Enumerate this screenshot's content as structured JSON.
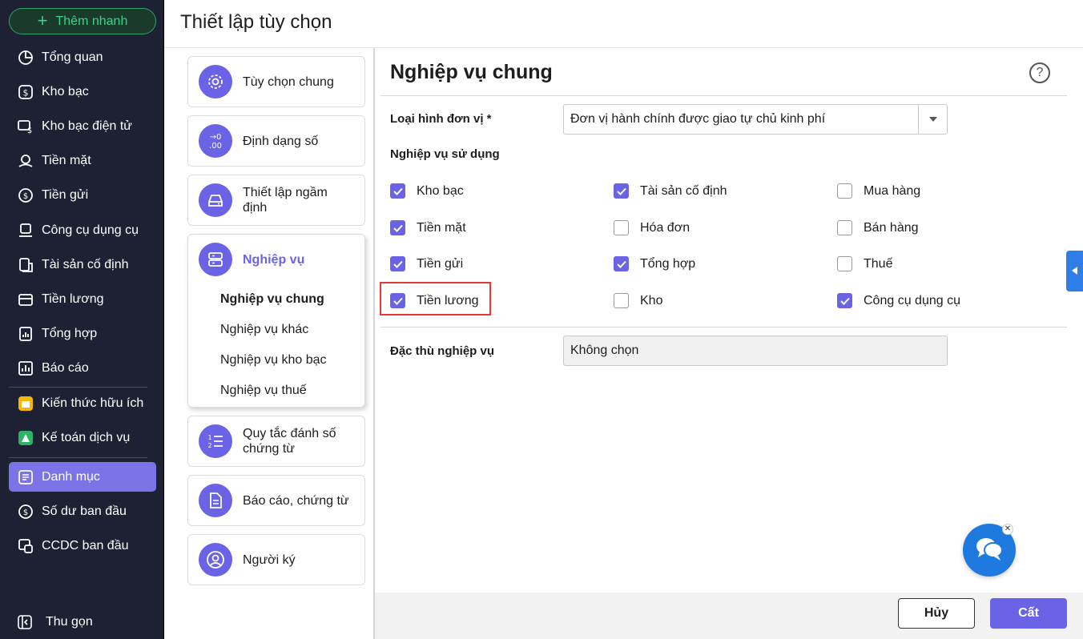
{
  "sidebar": {
    "quick_add_label": "Thêm nhanh",
    "items": [
      {
        "label": "Tổng quan",
        "icon": "pie-chart-icon"
      },
      {
        "label": "Kho bạc",
        "icon": "dollar-icon"
      },
      {
        "label": "Kho bạc điện tử",
        "icon": "e-treasury-icon"
      },
      {
        "label": "Tiền mặt",
        "icon": "cash-icon"
      },
      {
        "label": "Tiền gửi",
        "icon": "deposit-icon"
      },
      {
        "label": "Công cụ dụng cụ",
        "icon": "tools-icon"
      },
      {
        "label": "Tài sản cố định",
        "icon": "assets-icon"
      },
      {
        "label": "Tiền lương",
        "icon": "salary-icon"
      },
      {
        "label": "Tổng hợp",
        "icon": "summary-icon"
      },
      {
        "label": "Báo cáo",
        "icon": "report-icon"
      },
      {
        "label": "Kiến thức hữu ích",
        "icon": "knowledge-icon"
      },
      {
        "label": "Kế toán dịch vụ",
        "icon": "service-icon"
      },
      {
        "label": "Danh mục",
        "icon": "catalog-icon"
      },
      {
        "label": "Số dư ban đầu",
        "icon": "opening-balance-icon"
      },
      {
        "label": "CCDC ban đầu",
        "icon": "opening-tools-icon"
      }
    ],
    "collapse_label": "Thu gọn"
  },
  "page": {
    "title": "Thiết lập tùy chọn"
  },
  "menu": {
    "general": "Tùy chọn chung",
    "number_format": "Định dạng số",
    "defaults": "Thiết lập ngầm định",
    "business": "Nghiệp vụ",
    "sub": [
      "Nghiệp vụ chung",
      "Nghiệp vụ khác",
      "Nghiệp vụ kho bạc",
      "Nghiệp vụ thuế"
    ],
    "numbering": "Quy tắc đánh số chứng từ",
    "reports": "Báo cáo, chứng từ",
    "signer": "Người ký"
  },
  "content": {
    "title": "Nghiệp vụ chung",
    "help": "?",
    "unit_type_label": "Loại hình đơn vị *",
    "unit_type_value": "Đơn vị hành chính được giao tự chủ kinh phí",
    "used_label": "Nghiệp vụ sử dụng",
    "checkboxes": [
      {
        "label": "Kho bạc",
        "checked": true
      },
      {
        "label": "Tài sản cố định",
        "checked": true
      },
      {
        "label": "Mua hàng",
        "checked": false
      },
      {
        "label": "Tiền mặt",
        "checked": true
      },
      {
        "label": "Hóa đơn",
        "checked": false
      },
      {
        "label": "Bán hàng",
        "checked": false
      },
      {
        "label": "Tiền gửi",
        "checked": true
      },
      {
        "label": "Tổng hợp",
        "checked": true
      },
      {
        "label": "Thuế",
        "checked": false
      },
      {
        "label": "Tiền lương",
        "checked": true
      },
      {
        "label": "Kho",
        "checked": false
      },
      {
        "label": "Công cụ dụng cụ",
        "checked": true
      }
    ],
    "specific_label": "Đặc thù nghiệp vụ",
    "specific_value": "Không chọn"
  },
  "footer": {
    "cancel": "Hủy",
    "save": "Cất"
  },
  "colors": {
    "accent": "#6b63e6",
    "sidebar_bg": "#1e2133",
    "highlight": "#e33a3a",
    "chat": "#1f7ae0"
  }
}
